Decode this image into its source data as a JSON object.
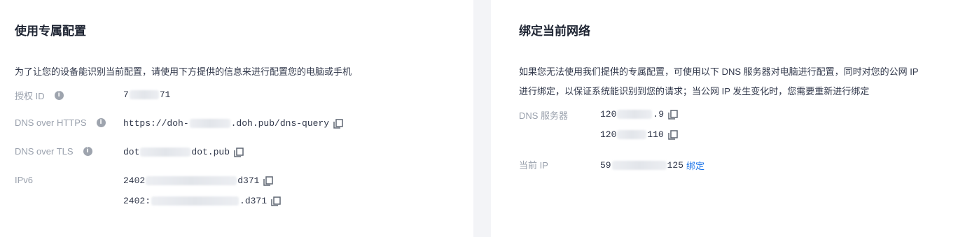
{
  "left": {
    "title": "使用专属配置",
    "description": "为了让您的设备能识别当前配置，请使用下方提供的信息来进行配置您的电脑或手机",
    "rows": {
      "auth_id": {
        "label": "授权 ID",
        "prefix": "7",
        "suffix": "71"
      },
      "doh": {
        "label": "DNS over HTTPS",
        "prefix": "https://doh-",
        "suffix": ".doh.pub/dns-query"
      },
      "dot": {
        "label": "DNS over TLS",
        "prefix": "dot",
        "suffix": "dot.pub"
      },
      "ipv6": {
        "label": "IPv6",
        "values": [
          {
            "prefix": "2402",
            "suffix": "d371"
          },
          {
            "prefix": "2402:",
            "suffix": ".d371"
          }
        ]
      }
    }
  },
  "right": {
    "title": "绑定当前网络",
    "description_line1": "如果您无法使用我们提供的专属配置，可使用以下 DNS 服务器对电脑进行配置，同时对您的公网 IP",
    "description_line2": "进行绑定，以保证系统能识别到您的请求；当公网 IP 发生变化时，您需要重新进行绑定",
    "dns_servers": {
      "label": "DNS 服务器",
      "values": [
        {
          "prefix": "120",
          "suffix": ".9"
        },
        {
          "prefix": "120",
          "suffix": "110"
        }
      ]
    },
    "current_ip": {
      "label": "当前 IP",
      "prefix": "59",
      "suffix": "125",
      "bind_label": "绑定"
    }
  },
  "icons": {
    "info": "info-icon",
    "copy": "copy-icon"
  },
  "colors": {
    "link": "#1a73e8",
    "label": "#9aa1ad",
    "text": "#30374a",
    "title": "#1f2533"
  }
}
